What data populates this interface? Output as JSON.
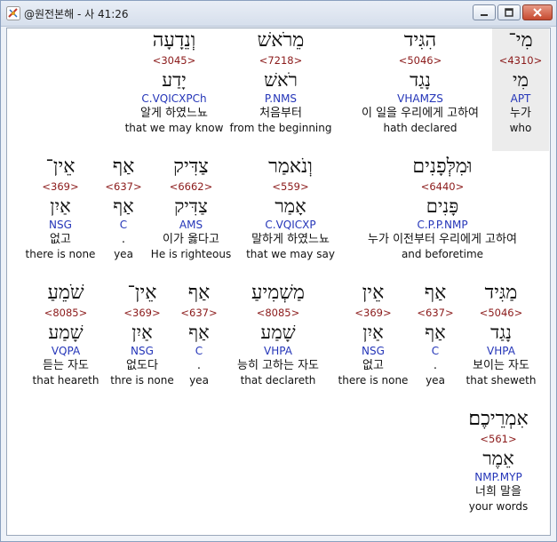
{
  "window": {
    "title": "@원전본해 - 사 41:26"
  },
  "words": [
    {
      "heb": "מִי־",
      "strong": "<4310>",
      "lemma": "מִי",
      "morph": "APT",
      "ko": "누가",
      "en": "who"
    },
    {
      "heb": "הִגִּיד",
      "strong": "<5046>",
      "lemma": "נָגַד",
      "morph": "VHAMZS",
      "ko": "이 일을 우리에게 고하여",
      "en": "hath declared"
    },
    {
      "heb": "מֵרֹאשׁ",
      "strong": "<7218>",
      "lemma": "רֹאשׁ",
      "morph": "P.NMS",
      "ko": "처음부터",
      "en": "from the beginning"
    },
    {
      "heb": "וְנֵדָעָה",
      "strong": "<3045>",
      "lemma": "יָדַע",
      "morph": "C.VQICXPCh",
      "ko": "알게 하였느뇨",
      "en": "that we may know"
    },
    {
      "heb": "וּמִלְּפָנִים",
      "strong": "<6440>",
      "lemma": "פָּנִים",
      "morph": "C.P.P.NMP",
      "ko": "누가 이전부터 우리에게 고하여",
      "en": "and beforetime"
    },
    {
      "heb": "וְנֹאמַר",
      "strong": "<559>",
      "lemma": "אָמַר",
      "morph": "C.VQICXP",
      "ko": "말하게 하였느뇨",
      "en": "that we may say"
    },
    {
      "heb": "צַדִּיק",
      "strong": "<6662>",
      "lemma": "צַדִּיק",
      "morph": "AMS",
      "ko": "이가 옳다고",
      "en": "He is righteous"
    },
    {
      "heb": "אַף",
      "strong": "<637>",
      "lemma": "אַף",
      "morph": "C",
      "ko": ".",
      "en": "yea"
    },
    {
      "heb": "אֵין־",
      "strong": "<369>",
      "lemma": "אַיִן",
      "morph": "NSG",
      "ko": "없고",
      "en": "there is none"
    },
    {
      "heb": "מַגִּיד",
      "strong": "<5046>",
      "lemma": "נָגַד",
      "morph": "VHPA",
      "ko": "보이는 자도",
      "en": "that sheweth"
    },
    {
      "heb": "אַף",
      "strong": "<637>",
      "lemma": "אַף",
      "morph": "C",
      "ko": ".",
      "en": "yea"
    },
    {
      "heb": "אֵין",
      "strong": "<369>",
      "lemma": "אַיִן",
      "morph": "NSG",
      "ko": "없고",
      "en": "there is none"
    },
    {
      "heb": "מַשְׁמִיעַ",
      "strong": "<8085>",
      "lemma": "שָׁמַע",
      "morph": "VHPA",
      "ko": "능히 고하는 자도",
      "en": "that declareth"
    },
    {
      "heb": "אַף",
      "strong": "<637>",
      "lemma": "אַף",
      "morph": "C",
      "ko": ".",
      "en": "yea"
    },
    {
      "heb": "אֵין־",
      "strong": "<369>",
      "lemma": "אַיִן",
      "morph": "NSG",
      "ko": "없도다",
      "en": "thre is none"
    },
    {
      "heb": "שֹׁמֵעַ",
      "strong": "<8085>",
      "lemma": "שָׁמַע",
      "morph": "VQPA",
      "ko": "듣는 자도",
      "en": "that heareth"
    },
    {
      "heb": "אִמְרֵיכֶם׃",
      "strong": "<561>",
      "lemma": "אֵמֶר",
      "morph": "NMP.MYP",
      "ko": "너희 말을",
      "en": "your words"
    }
  ]
}
